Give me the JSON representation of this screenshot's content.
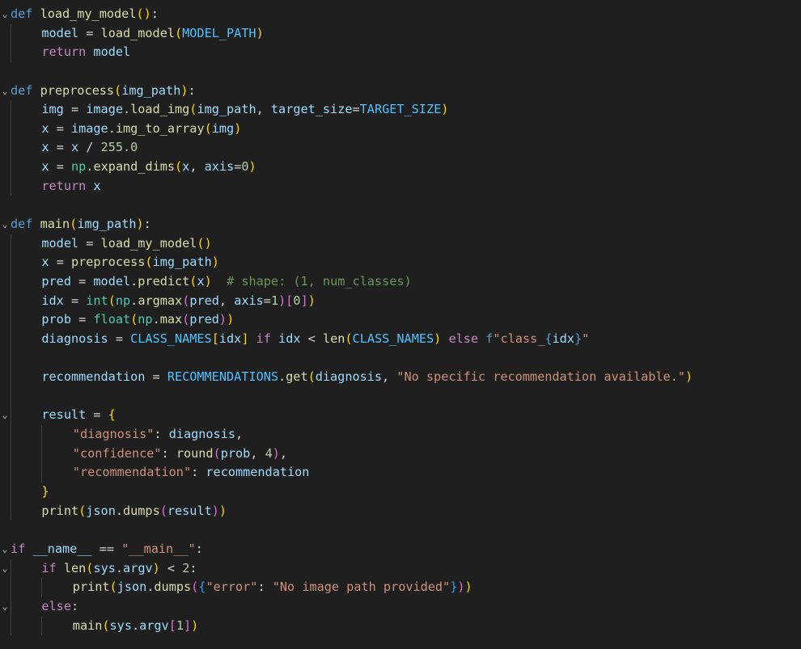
{
  "editor": {
    "colors": {
      "background": "#1f1f1f",
      "keyword": "#569cd6",
      "control": "#c586c0",
      "function": "#dcdcaa",
      "variable": "#9cdcfe",
      "builtin_type": "#4ec9b0",
      "constant": "#4fc1ff",
      "string": "#ce9178",
      "number": "#b5cea8",
      "comment": "#6a9955",
      "bracket_1": "#ffd700",
      "bracket_2": "#da70d6",
      "bracket_3": "#179fff"
    },
    "fold_icon": "chevron-down-icon",
    "lines": [
      {
        "fold": true,
        "indent": 0,
        "tokens": [
          [
            "kw",
            "def"
          ],
          [
            "pl",
            " "
          ],
          [
            "fn",
            "load_my_model"
          ],
          [
            "br1",
            "()"
          ],
          [
            "pl",
            ":"
          ]
        ]
      },
      {
        "fold": false,
        "indent": 1,
        "tokens": [
          [
            "var",
            "model"
          ],
          [
            "pl",
            " = "
          ],
          [
            "fn",
            "load_model"
          ],
          [
            "br1",
            "("
          ],
          [
            "con",
            "MODEL_PATH"
          ],
          [
            "br1",
            ")"
          ]
        ]
      },
      {
        "fold": false,
        "indent": 1,
        "tokens": [
          [
            "ctl",
            "return"
          ],
          [
            "pl",
            " "
          ],
          [
            "var",
            "model"
          ]
        ]
      },
      {
        "fold": false,
        "indent": 0,
        "tokens": []
      },
      {
        "fold": true,
        "indent": 0,
        "tokens": [
          [
            "kw",
            "def"
          ],
          [
            "pl",
            " "
          ],
          [
            "fn",
            "preprocess"
          ],
          [
            "br1",
            "("
          ],
          [
            "var",
            "img_path"
          ],
          [
            "br1",
            ")"
          ],
          [
            "pl",
            ":"
          ]
        ]
      },
      {
        "fold": false,
        "indent": 1,
        "tokens": [
          [
            "var",
            "img"
          ],
          [
            "pl",
            " = "
          ],
          [
            "var",
            "image"
          ],
          [
            "pl",
            "."
          ],
          [
            "fn",
            "load_img"
          ],
          [
            "br1",
            "("
          ],
          [
            "var",
            "img_path"
          ],
          [
            "pl",
            ", "
          ],
          [
            "var",
            "target_size"
          ],
          [
            "pl",
            "="
          ],
          [
            "con",
            "TARGET_SIZE"
          ],
          [
            "br1",
            ")"
          ]
        ]
      },
      {
        "fold": false,
        "indent": 1,
        "tokens": [
          [
            "var",
            "x"
          ],
          [
            "pl",
            " = "
          ],
          [
            "var",
            "image"
          ],
          [
            "pl",
            "."
          ],
          [
            "fn",
            "img_to_array"
          ],
          [
            "br1",
            "("
          ],
          [
            "var",
            "img"
          ],
          [
            "br1",
            ")"
          ]
        ]
      },
      {
        "fold": false,
        "indent": 1,
        "tokens": [
          [
            "var",
            "x"
          ],
          [
            "pl",
            " = "
          ],
          [
            "var",
            "x"
          ],
          [
            "pl",
            " / "
          ],
          [
            "num",
            "255.0"
          ]
        ]
      },
      {
        "fold": false,
        "indent": 1,
        "tokens": [
          [
            "var",
            "x"
          ],
          [
            "pl",
            " = "
          ],
          [
            "cls",
            "np"
          ],
          [
            "pl",
            "."
          ],
          [
            "fn",
            "expand_dims"
          ],
          [
            "br1",
            "("
          ],
          [
            "var",
            "x"
          ],
          [
            "pl",
            ", "
          ],
          [
            "var",
            "axis"
          ],
          [
            "pl",
            "="
          ],
          [
            "num",
            "0"
          ],
          [
            "br1",
            ")"
          ]
        ]
      },
      {
        "fold": false,
        "indent": 1,
        "tokens": [
          [
            "ctl",
            "return"
          ],
          [
            "pl",
            " "
          ],
          [
            "var",
            "x"
          ]
        ]
      },
      {
        "fold": false,
        "indent": 0,
        "tokens": []
      },
      {
        "fold": true,
        "indent": 0,
        "tokens": [
          [
            "kw",
            "def"
          ],
          [
            "pl",
            " "
          ],
          [
            "fn",
            "main"
          ],
          [
            "br1",
            "("
          ],
          [
            "var",
            "img_path"
          ],
          [
            "br1",
            ")"
          ],
          [
            "pl",
            ":"
          ]
        ]
      },
      {
        "fold": false,
        "indent": 1,
        "tokens": [
          [
            "var",
            "model"
          ],
          [
            "pl",
            " = "
          ],
          [
            "fn",
            "load_my_model"
          ],
          [
            "br1",
            "()"
          ]
        ]
      },
      {
        "fold": false,
        "indent": 1,
        "tokens": [
          [
            "var",
            "x"
          ],
          [
            "pl",
            " = "
          ],
          [
            "fn",
            "preprocess"
          ],
          [
            "br1",
            "("
          ],
          [
            "var",
            "img_path"
          ],
          [
            "br1",
            ")"
          ]
        ]
      },
      {
        "fold": false,
        "indent": 1,
        "tokens": [
          [
            "var",
            "pred"
          ],
          [
            "pl",
            " = "
          ],
          [
            "var",
            "model"
          ],
          [
            "pl",
            "."
          ],
          [
            "fn",
            "predict"
          ],
          [
            "br1",
            "("
          ],
          [
            "var",
            "x"
          ],
          [
            "br1",
            ")"
          ],
          [
            "pl",
            "  "
          ],
          [
            "com",
            "# shape: (1, num_classes)"
          ]
        ]
      },
      {
        "fold": false,
        "indent": 1,
        "tokens": [
          [
            "var",
            "idx"
          ],
          [
            "pl",
            " = "
          ],
          [
            "cls",
            "int"
          ],
          [
            "br1",
            "("
          ],
          [
            "cls",
            "np"
          ],
          [
            "pl",
            "."
          ],
          [
            "fn",
            "argmax"
          ],
          [
            "br2",
            "("
          ],
          [
            "var",
            "pred"
          ],
          [
            "pl",
            ", "
          ],
          [
            "var",
            "axis"
          ],
          [
            "pl",
            "="
          ],
          [
            "num",
            "1"
          ],
          [
            "br2",
            ")"
          ],
          [
            "br2",
            "["
          ],
          [
            "num",
            "0"
          ],
          [
            "br2",
            "]"
          ],
          [
            "br1",
            ")"
          ]
        ]
      },
      {
        "fold": false,
        "indent": 1,
        "tokens": [
          [
            "var",
            "prob"
          ],
          [
            "pl",
            " = "
          ],
          [
            "cls",
            "float"
          ],
          [
            "br1",
            "("
          ],
          [
            "cls",
            "np"
          ],
          [
            "pl",
            "."
          ],
          [
            "fn",
            "max"
          ],
          [
            "br2",
            "("
          ],
          [
            "var",
            "pred"
          ],
          [
            "br2",
            ")"
          ],
          [
            "br1",
            ")"
          ]
        ]
      },
      {
        "fold": false,
        "indent": 1,
        "tokens": [
          [
            "var",
            "diagnosis"
          ],
          [
            "pl",
            " = "
          ],
          [
            "con",
            "CLASS_NAMES"
          ],
          [
            "br1",
            "["
          ],
          [
            "var",
            "idx"
          ],
          [
            "br1",
            "]"
          ],
          [
            "pl",
            " "
          ],
          [
            "ctl",
            "if"
          ],
          [
            "pl",
            " "
          ],
          [
            "var",
            "idx"
          ],
          [
            "pl",
            " < "
          ],
          [
            "fn",
            "len"
          ],
          [
            "br1",
            "("
          ],
          [
            "con",
            "CLASS_NAMES"
          ],
          [
            "br1",
            ")"
          ],
          [
            "pl",
            " "
          ],
          [
            "ctl",
            "else"
          ],
          [
            "pl",
            " "
          ],
          [
            "kw",
            "f"
          ],
          [
            "str",
            "\"class_"
          ],
          [
            "kw",
            "{"
          ],
          [
            "var",
            "idx"
          ],
          [
            "kw",
            "}"
          ],
          [
            "str",
            "\""
          ]
        ]
      },
      {
        "fold": false,
        "indent": 1,
        "tokens": []
      },
      {
        "fold": false,
        "indent": 1,
        "tokens": [
          [
            "var",
            "recommendation"
          ],
          [
            "pl",
            " = "
          ],
          [
            "con",
            "RECOMMENDATIONS"
          ],
          [
            "pl",
            "."
          ],
          [
            "fn",
            "get"
          ],
          [
            "br1",
            "("
          ],
          [
            "var",
            "diagnosis"
          ],
          [
            "pl",
            ", "
          ],
          [
            "str",
            "\"No specific recommendation available.\""
          ],
          [
            "br1",
            ")"
          ]
        ]
      },
      {
        "fold": false,
        "indent": 1,
        "tokens": []
      },
      {
        "fold": true,
        "indent": 1,
        "tokens": [
          [
            "var",
            "result"
          ],
          [
            "pl",
            " = "
          ],
          [
            "br1",
            "{"
          ]
        ]
      },
      {
        "fold": false,
        "indent": 2,
        "tokens": [
          [
            "str",
            "\"diagnosis\""
          ],
          [
            "pl",
            ": "
          ],
          [
            "var",
            "diagnosis"
          ],
          [
            "pl",
            ","
          ]
        ]
      },
      {
        "fold": false,
        "indent": 2,
        "tokens": [
          [
            "str",
            "\"confidence\""
          ],
          [
            "pl",
            ": "
          ],
          [
            "fn",
            "round"
          ],
          [
            "br2",
            "("
          ],
          [
            "var",
            "prob"
          ],
          [
            "pl",
            ", "
          ],
          [
            "num",
            "4"
          ],
          [
            "br2",
            ")"
          ],
          [
            "pl",
            ","
          ]
        ]
      },
      {
        "fold": false,
        "indent": 2,
        "tokens": [
          [
            "str",
            "\"recommendation\""
          ],
          [
            "pl",
            ": "
          ],
          [
            "var",
            "recommendation"
          ]
        ]
      },
      {
        "fold": false,
        "indent": 1,
        "tokens": [
          [
            "br1",
            "}"
          ]
        ]
      },
      {
        "fold": false,
        "indent": 1,
        "tokens": [
          [
            "fn",
            "print"
          ],
          [
            "br1",
            "("
          ],
          [
            "var",
            "json"
          ],
          [
            "pl",
            "."
          ],
          [
            "fn",
            "dumps"
          ],
          [
            "br2",
            "("
          ],
          [
            "var",
            "result"
          ],
          [
            "br2",
            ")"
          ],
          [
            "br1",
            ")"
          ]
        ]
      },
      {
        "fold": false,
        "indent": 0,
        "tokens": []
      },
      {
        "fold": true,
        "indent": 0,
        "tokens": [
          [
            "ctl",
            "if"
          ],
          [
            "pl",
            " "
          ],
          [
            "var",
            "__name__"
          ],
          [
            "pl",
            " == "
          ],
          [
            "str",
            "\"__main__\""
          ],
          [
            "pl",
            ":"
          ]
        ]
      },
      {
        "fold": true,
        "indent": 1,
        "tokens": [
          [
            "ctl",
            "if"
          ],
          [
            "pl",
            " "
          ],
          [
            "fn",
            "len"
          ],
          [
            "br1",
            "("
          ],
          [
            "var",
            "sys"
          ],
          [
            "pl",
            "."
          ],
          [
            "var",
            "argv"
          ],
          [
            "br1",
            ")"
          ],
          [
            "pl",
            " < "
          ],
          [
            "num",
            "2"
          ],
          [
            "pl",
            ":"
          ]
        ]
      },
      {
        "fold": false,
        "indent": 2,
        "tokens": [
          [
            "fn",
            "print"
          ],
          [
            "br1",
            "("
          ],
          [
            "var",
            "json"
          ],
          [
            "pl",
            "."
          ],
          [
            "fn",
            "dumps"
          ],
          [
            "br2",
            "("
          ],
          [
            "br3",
            "{"
          ],
          [
            "str",
            "\"error\""
          ],
          [
            "pl",
            ": "
          ],
          [
            "str",
            "\"No image path provided\""
          ],
          [
            "br3",
            "}"
          ],
          [
            "br2",
            ")"
          ],
          [
            "br1",
            ")"
          ]
        ]
      },
      {
        "fold": true,
        "indent": 1,
        "tokens": [
          [
            "ctl",
            "else"
          ],
          [
            "pl",
            ":"
          ]
        ]
      },
      {
        "fold": false,
        "indent": 2,
        "tokens": [
          [
            "fn",
            "main"
          ],
          [
            "br1",
            "("
          ],
          [
            "var",
            "sys"
          ],
          [
            "pl",
            "."
          ],
          [
            "var",
            "argv"
          ],
          [
            "br2",
            "["
          ],
          [
            "num",
            "1"
          ],
          [
            "br2",
            "]"
          ],
          [
            "br1",
            ")"
          ]
        ]
      }
    ]
  }
}
